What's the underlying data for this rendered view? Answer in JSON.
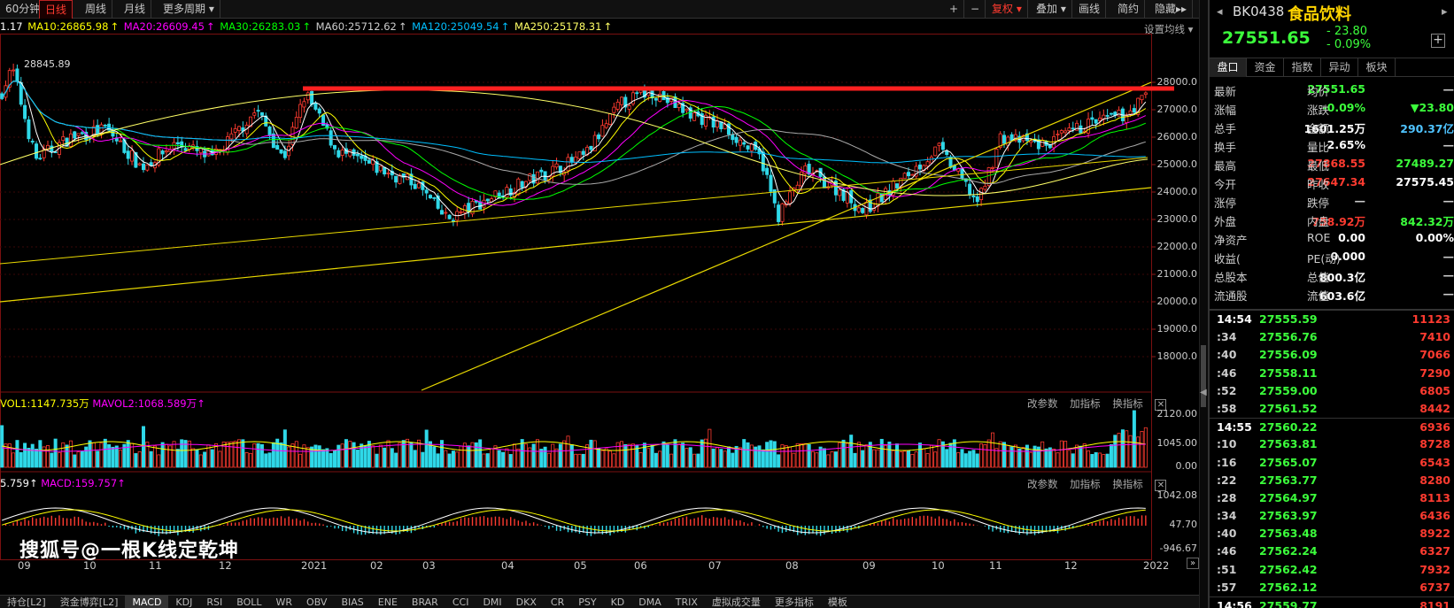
{
  "toolbar": {
    "periods": [
      "60分钟",
      "日线",
      "周线",
      "月线",
      "更多周期"
    ],
    "active_period": "日线",
    "right_buttons": [
      "+",
      "−",
      "复权",
      "叠加",
      "画线",
      "简约",
      "隐藏"
    ],
    "fuquan": "复权"
  },
  "ma_legend": {
    "ma5": "1.17",
    "ma10": "MA10:26865.98",
    "ma20": "MA20:26609.45",
    "ma30": "MA30:26283.03",
    "ma60": "MA60:25712.62",
    "ma120": "MA120:25049.54",
    "ma250": "MA250:25178.31",
    "settings": "设置均线"
  },
  "price_axis": [
    "28000.0",
    "27000.0",
    "26000.0",
    "25000.0",
    "24000.0",
    "23000.0",
    "22000.0",
    "21000.0",
    "20000.0",
    "19000.0",
    "18000.0"
  ],
  "high_marker": "28845.89",
  "volume_pane": {
    "vol1": "VOL1:1147.735万",
    "vol2": "MAVOL2:1068.589万",
    "axis": [
      "2120.00",
      "1045.00",
      "0.00"
    ],
    "tools": [
      "改参数",
      "加指标",
      "换指标"
    ]
  },
  "macd_pane": {
    "dif": "5.759",
    "macd": "MACD:159.757",
    "axis": [
      "1042.08",
      "47.70",
      "-946.67"
    ],
    "tools": [
      "改参数",
      "加指标",
      "换指标"
    ]
  },
  "months": [
    "09",
    "10",
    "11",
    "12",
    "2021",
    "02",
    "03",
    "04",
    "05",
    "06",
    "07",
    "08",
    "09",
    "10",
    "11",
    "12",
    "2022"
  ],
  "indicator_tabs": [
    "持仓[L2]",
    "资金博弈[L2]",
    "MACD",
    "KDJ",
    "RSI",
    "BOLL",
    "WR",
    "OBV",
    "BIAS",
    "ENE",
    "BRAR",
    "CCI",
    "DMI",
    "DKX",
    "CR",
    "PSY",
    "KD",
    "DMA",
    "TRIX",
    "虚拟成交量",
    "更多指标",
    "模板"
  ],
  "active_indicator": "MACD",
  "watermark": "搜狐号@一根K线定乾坤",
  "right_panel": {
    "code": "BK0438",
    "name": "食品饮料",
    "price": "27551.65",
    "change": "- 23.80",
    "change_pct": "- 0.09%",
    "tabs": [
      "盘口",
      "资金",
      "指数",
      "异动",
      "板块"
    ],
    "active_tab": "盘口",
    "quotes": [
      {
        "l1": "最新",
        "v1": "27551.65",
        "c1": "#3cff3c",
        "l2": "均价",
        "v2": "—",
        "c2": "#ccc"
      },
      {
        "l1": "涨幅",
        "v1": "-0.09%",
        "c1": "#3cff3c",
        "l2": "涨跌",
        "v2": "▼23.80",
        "c2": "#3cff3c"
      },
      {
        "l1": "总手",
        "v1": "1601.25万",
        "c1": "#fff",
        "l2": "金额",
        "v2": "290.37亿",
        "c2": "#4fc3ff"
      },
      {
        "l1": "换手",
        "v1": "2.65%",
        "c1": "#fff",
        "l2": "量比",
        "v2": "—",
        "c2": "#ccc"
      },
      {
        "l1": "最高",
        "v1": "27868.55",
        "c1": "#ff3b30",
        "l2": "最低",
        "v2": "27489.27",
        "c2": "#3cff3c"
      },
      {
        "l1": "今开",
        "v1": "27647.34",
        "c1": "#ff3b30",
        "l2": "昨收",
        "v2": "27575.45",
        "c2": "#fff"
      },
      {
        "l1": "涨停",
        "v1": "—",
        "c1": "#ccc",
        "l2": "跌停",
        "v2": "—",
        "c2": "#ccc"
      },
      {
        "l1": "外盘",
        "v1": "758.92万",
        "c1": "#ff3b30",
        "l2": "内盘",
        "v2": "842.32万",
        "c2": "#3cff3c"
      },
      {
        "l1": "净资产",
        "v1": "0.00",
        "c1": "#fff",
        "l2": "ROE",
        "v2": "0.00%",
        "c2": "#fff"
      },
      {
        "l1": "收益(",
        "v1": "0.000",
        "c1": "#fff",
        "l2": "PE(动)",
        "v2": "—",
        "c2": "#ccc"
      },
      {
        "l1": "总股本",
        "v1": "800.3亿",
        "c1": "#fff",
        "l2": "总值",
        "v2": "—",
        "c2": "#ccc"
      },
      {
        "l1": "流通股",
        "v1": "603.6亿",
        "c1": "#fff",
        "l2": "流值",
        "v2": "—",
        "c2": "#ccc"
      }
    ],
    "ticks": [
      {
        "t": "14:54",
        "p": "27555.59",
        "v": "11123",
        "hour": true
      },
      {
        "t": ":34",
        "p": "27556.76",
        "v": "7410"
      },
      {
        "t": ":40",
        "p": "27556.09",
        "v": "7066"
      },
      {
        "t": ":46",
        "p": "27558.11",
        "v": "7290"
      },
      {
        "t": ":52",
        "p": "27559.00",
        "v": "6805"
      },
      {
        "t": ":58",
        "p": "27561.52",
        "v": "8442"
      },
      {
        "t": "14:55",
        "p": "27560.22",
        "v": "6936",
        "hour": true
      },
      {
        "t": ":10",
        "p": "27563.81",
        "v": "8728"
      },
      {
        "t": ":16",
        "p": "27565.07",
        "v": "6543"
      },
      {
        "t": ":22",
        "p": "27563.77",
        "v": "8280"
      },
      {
        "t": ":28",
        "p": "27564.97",
        "v": "8113"
      },
      {
        "t": ":34",
        "p": "27563.97",
        "v": "6436"
      },
      {
        "t": ":40",
        "p": "27563.48",
        "v": "8922"
      },
      {
        "t": ":46",
        "p": "27562.24",
        "v": "6327"
      },
      {
        "t": ":51",
        "p": "27562.42",
        "v": "7932"
      },
      {
        "t": ":57",
        "p": "27562.12",
        "v": "6737"
      },
      {
        "t": "14:56",
        "p": "27559.77",
        "v": "8191",
        "hour": true
      }
    ]
  },
  "colors": {
    "up": "#ff3b30",
    "down": "#3cff3c",
    "cyan_bar": "#2fd8e8",
    "ma5": "#ffffff",
    "ma10": "#ffff00",
    "ma20": "#ff00ff",
    "ma30": "#00ff00",
    "ma60": "#aaaaaa",
    "ma120": "#00bfff",
    "ma250": "#ffff66",
    "resistance": "#ff2020"
  }
}
